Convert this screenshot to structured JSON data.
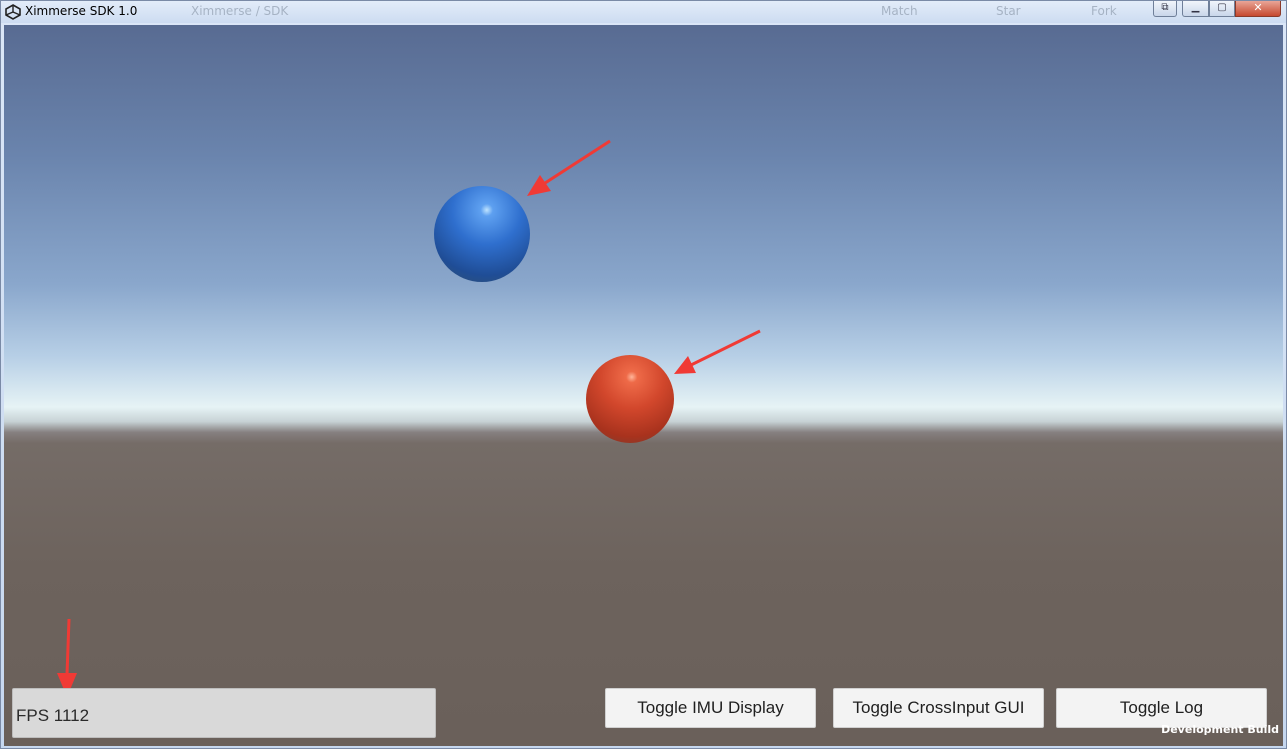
{
  "window": {
    "title": "Ximmerse SDK 1.0",
    "ghost_tab": "Ximmerse / SDK",
    "ghost_match": "Match",
    "ghost_star": "Star",
    "ghost_fresh": "Fork",
    "controls": {
      "snap": "⧉",
      "minimize": "▁",
      "maximize": "▢",
      "close": "✕"
    }
  },
  "scene": {
    "sky_top_color": "#586b92",
    "horizon_color": "#e6f3f5",
    "ground_color": "#6d635d",
    "spheres": [
      {
        "name": "blue-sphere",
        "color": "#2f6fce"
      },
      {
        "name": "red-sphere",
        "color": "#d2472c"
      }
    ],
    "annotation_arrow_color": "#f03a35"
  },
  "gui": {
    "fps_label": "FPS 1112",
    "buttons": {
      "imu": "Toggle IMU Display",
      "crossinput": "Toggle CrossInput GUI",
      "log": "Toggle Log"
    },
    "dev_build": "Development Build"
  }
}
